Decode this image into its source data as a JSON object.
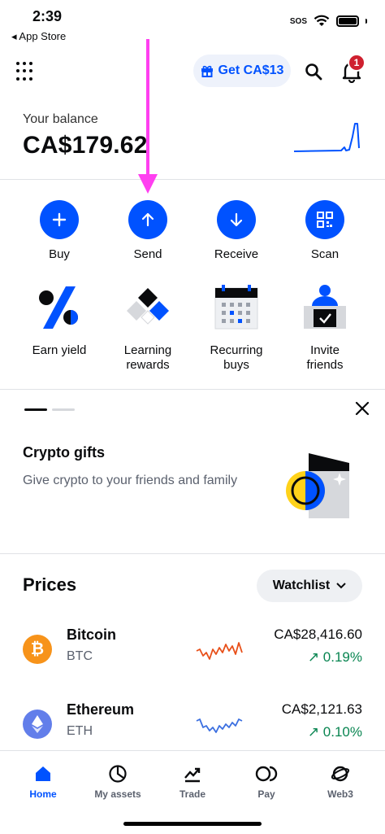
{
  "status_bar": {
    "time": "2:39",
    "back_label": "◂ App Store",
    "sos": "SOS"
  },
  "header": {
    "promo_button": "Get CA$13",
    "notification_count": "1"
  },
  "balance": {
    "label": "Your balance",
    "value": "CA$179.62"
  },
  "actions": [
    {
      "label": "Buy",
      "icon": "plus-icon"
    },
    {
      "label": "Send",
      "icon": "arrow-up-icon"
    },
    {
      "label": "Receive",
      "icon": "arrow-down-icon"
    },
    {
      "label": "Scan",
      "icon": "qr-icon"
    }
  ],
  "features": [
    {
      "line1": "Earn yield",
      "line2": ""
    },
    {
      "line1": "Learning",
      "line2": "rewards"
    },
    {
      "line1": "Recurring",
      "line2": "buys"
    },
    {
      "line1": "Invite",
      "line2": "friends"
    }
  ],
  "promo": {
    "title": "Crypto gifts",
    "text": "Give crypto to your friends and family"
  },
  "prices": {
    "title": "Prices",
    "watchlist_label": "Watchlist",
    "coins": [
      {
        "name": "Bitcoin",
        "symbol": "BTC",
        "price": "CA$28,416.60",
        "change": "↗ 0.19%",
        "color": "#f7931a",
        "spark_color": "#e8501a"
      },
      {
        "name": "Ethereum",
        "symbol": "ETH",
        "price": "CA$2,121.63",
        "change": "↗ 0.10%",
        "color": "#627eea",
        "spark_color": "#3b6fe0"
      }
    ]
  },
  "nav": [
    {
      "label": "Home",
      "icon": "home-icon",
      "active": true
    },
    {
      "label": "My assets",
      "icon": "pie-chart-icon"
    },
    {
      "label": "Trade",
      "icon": "trade-icon"
    },
    {
      "label": "Pay",
      "icon": "pay-icon"
    },
    {
      "label": "Web3",
      "icon": "web3-icon"
    }
  ],
  "colors": {
    "accent": "#0052ff",
    "annotation": "#ff3ff0",
    "positive": "#098551",
    "badge": "#cf202f"
  }
}
